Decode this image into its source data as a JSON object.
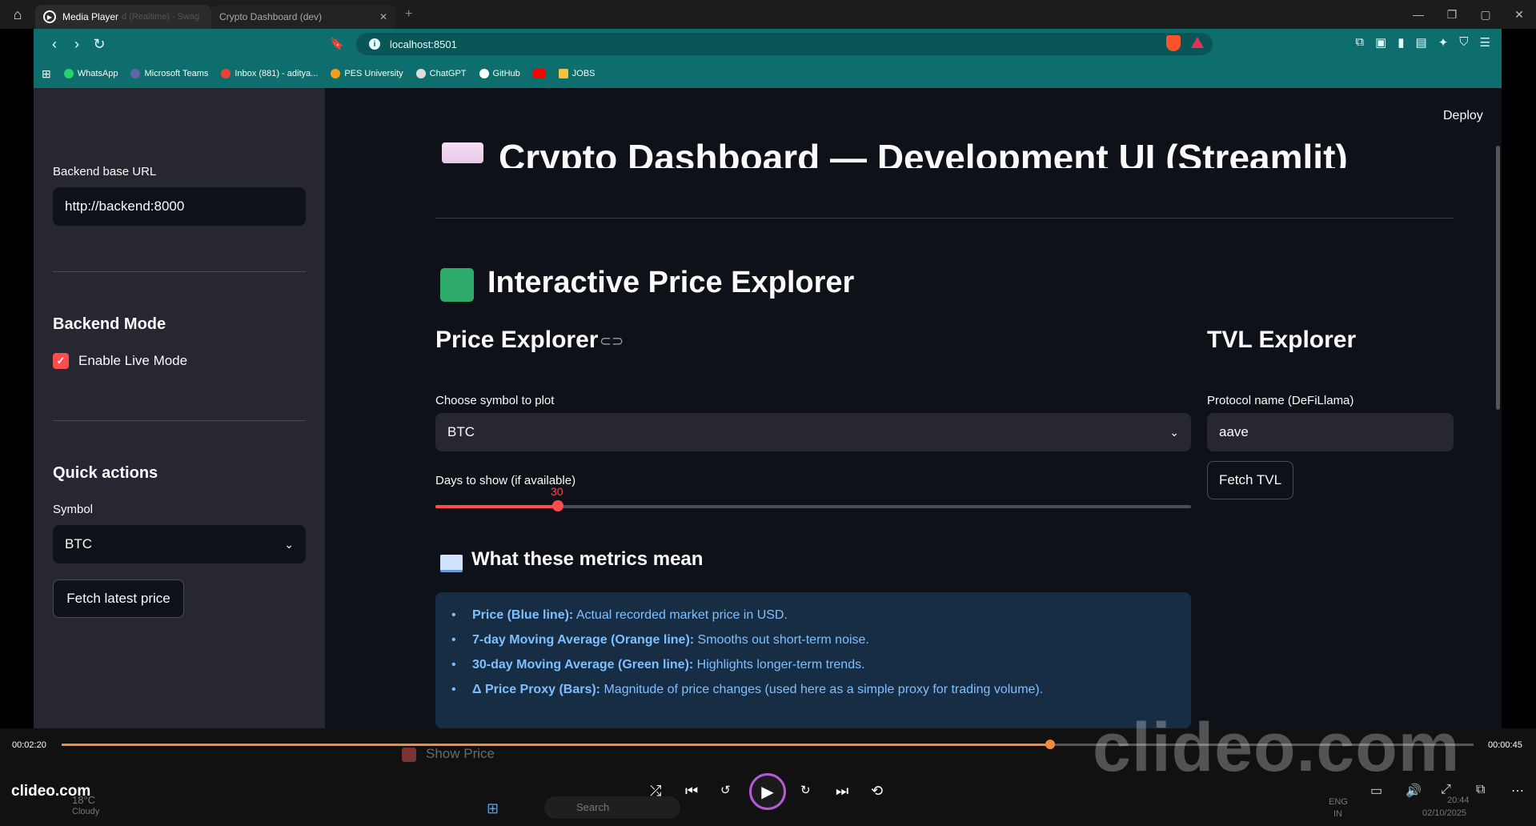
{
  "player": {
    "tab1_title": "Media Player",
    "tab1_faded": "d (Realtime) - Swag",
    "tab2_title": "Crypto Dashboard (dev)",
    "time_current": "00:02:20",
    "time_total": "00:00:45",
    "progress": 0.7,
    "watermark": "clideo.com",
    "brand": "clideo.com"
  },
  "browser": {
    "url": "localhost:8501",
    "bookmarks": [
      {
        "label": "WhatsApp",
        "color": "#25d366"
      },
      {
        "label": "Microsoft Teams",
        "color": "#6264a7"
      },
      {
        "label": "Inbox (881) - aditya...",
        "color": "#ea4335"
      },
      {
        "label": "PES University",
        "color": "#f59f1e"
      },
      {
        "label": "ChatGPT",
        "color": "#dddddd"
      },
      {
        "label": "GitHub",
        "color": "#ffffff"
      },
      {
        "label": "",
        "color": "#ff0000"
      },
      {
        "label": "JOBS",
        "color": "#f5c542"
      }
    ]
  },
  "sidebar": {
    "backend_label": "Backend base URL",
    "backend_value": "http://backend:8000",
    "mode_heading": "Backend Mode",
    "live_mode_label": "Enable Live Mode",
    "live_mode_checked": true,
    "quick_heading": "Quick actions",
    "symbol_label": "Symbol",
    "symbol_value": "BTC",
    "fetch_price_label": "Fetch latest price"
  },
  "main": {
    "deploy_label": "Deploy",
    "page_title": "Crypto Dashboard — Development UI (Streamlit)",
    "section_title": "Interactive Price Explorer",
    "price_explorer_heading": "Price Explorer",
    "tvl_heading": "TVL Explorer",
    "symbol_select_label": "Choose symbol to plot",
    "symbol_select_value": "BTC",
    "days_label": "Days to show (if available)",
    "days_value": "30",
    "days_fraction": 0.162,
    "protocol_label": "Protocol name (DeFiLlama)",
    "protocol_value": "aave",
    "fetch_tvl_label": "Fetch TVL",
    "metrics_heading": "What these metrics mean",
    "metrics": [
      {
        "term": "Price (Blue line):",
        "desc": "Actual recorded market price in USD."
      },
      {
        "term": "7-day Moving Average (Orange line):",
        "desc": "Smooths out short-term noise."
      },
      {
        "term": "30-day Moving Average (Green line):",
        "desc": "Highlights longer-term trends."
      },
      {
        "term": "Δ Price Proxy (Bars):",
        "desc": "Magnitude of price changes (used here as a simple proxy for trading volume)."
      }
    ],
    "show_price_label": "Show Price"
  },
  "taskbar": {
    "weather_temp": "18°C",
    "weather_desc": "Cloudy",
    "search_placeholder": "Search",
    "lang": "ENG",
    "region": "IN",
    "clock_time": "20:44",
    "clock_date": "02/10/2025"
  }
}
